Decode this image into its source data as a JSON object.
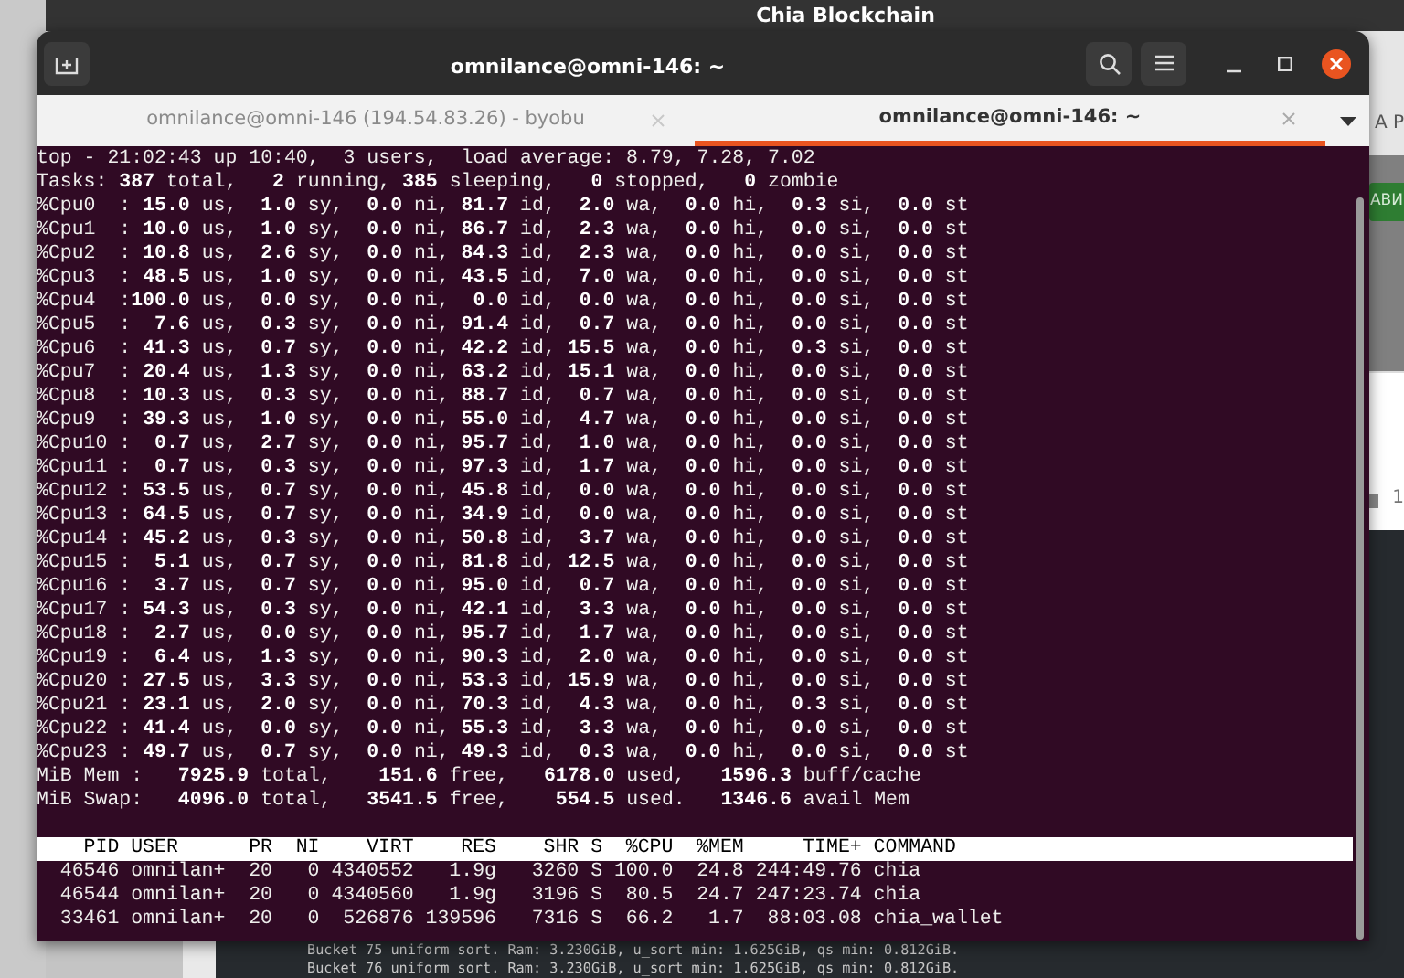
{
  "desktop": {
    "title": "Chia Blockchain"
  },
  "background_app": {
    "header_text": "A P",
    "button": "АВИ",
    "counter": "1",
    "log_lines": [
      "Bucket 75 uniform sort. Ram: 3.230GiB, u_sort min: 1.625GiB, qs min: 0.812GiB.",
      "Bucket 76 uniform sort. Ram: 3.230GiB, u_sort min: 1.625GiB, qs min: 0.812GiB."
    ]
  },
  "window": {
    "title": "omnilance@omni-146: ~"
  },
  "tabs": [
    {
      "label": "omnilance@omni-146 (194.54.83.26) - byobu",
      "selected": false
    },
    {
      "label": "omnilance@omni-146: ~",
      "selected": true
    }
  ],
  "terminal": {
    "lines": [
      "top - 21:02:43 up 10:40,  3 users,  load average: 8.79, 7.28, 7.02",
      "Tasks: **387** total,   **2** running, **385** sleeping,   **0** stopped,   **0** zombie",
      "%Cpu0  : **15.0** us,  **1.0** sy,  **0.0** ni, **81.7** id,  **2.0** wa,  **0.0** hi,  **0.3** si,  **0.0** st",
      "%Cpu1  : **10.0** us,  **1.0** sy,  **0.0** ni, **86.7** id,  **2.3** wa,  **0.0** hi,  **0.0** si,  **0.0** st",
      "%Cpu2  : **10.8** us,  **2.6** sy,  **0.0** ni, **84.3** id,  **2.3** wa,  **0.0** hi,  **0.0** si,  **0.0** st",
      "%Cpu3  : **48.5** us,  **1.0** sy,  **0.0** ni, **43.5** id,  **7.0** wa,  **0.0** hi,  **0.0** si,  **0.0** st",
      "%Cpu4  :**100.0** us,  **0.0** sy,  **0.0** ni,  **0.0** id,  **0.0** wa,  **0.0** hi,  **0.0** si,  **0.0** st",
      "%Cpu5  :  **7.6** us,  **0.3** sy,  **0.0** ni, **91.4** id,  **0.7** wa,  **0.0** hi,  **0.0** si,  **0.0** st",
      "%Cpu6  : **41.3** us,  **0.7** sy,  **0.0** ni, **42.2** id, **15.5** wa,  **0.0** hi,  **0.3** si,  **0.0** st",
      "%Cpu7  : **20.4** us,  **1.3** sy,  **0.0** ni, **63.2** id, **15.1** wa,  **0.0** hi,  **0.0** si,  **0.0** st",
      "%Cpu8  : **10.3** us,  **0.3** sy,  **0.0** ni, **88.7** id,  **0.7** wa,  **0.0** hi,  **0.0** si,  **0.0** st",
      "%Cpu9  : **39.3** us,  **1.0** sy,  **0.0** ni, **55.0** id,  **4.7** wa,  **0.0** hi,  **0.0** si,  **0.0** st",
      "%Cpu10 :  **0.7** us,  **2.7** sy,  **0.0** ni, **95.7** id,  **1.0** wa,  **0.0** hi,  **0.0** si,  **0.0** st",
      "%Cpu11 :  **0.7** us,  **0.3** sy,  **0.0** ni, **97.3** id,  **1.7** wa,  **0.0** hi,  **0.0** si,  **0.0** st",
      "%Cpu12 : **53.5** us,  **0.7** sy,  **0.0** ni, **45.8** id,  **0.0** wa,  **0.0** hi,  **0.0** si,  **0.0** st",
      "%Cpu13 : **64.5** us,  **0.7** sy,  **0.0** ni, **34.9** id,  **0.0** wa,  **0.0** hi,  **0.0** si,  **0.0** st",
      "%Cpu14 : **45.2** us,  **0.3** sy,  **0.0** ni, **50.8** id,  **3.7** wa,  **0.0** hi,  **0.0** si,  **0.0** st",
      "%Cpu15 :  **5.1** us,  **0.7** sy,  **0.0** ni, **81.8** id, **12.5** wa,  **0.0** hi,  **0.0** si,  **0.0** st",
      "%Cpu16 :  **3.7** us,  **0.7** sy,  **0.0** ni, **95.0** id,  **0.7** wa,  **0.0** hi,  **0.0** si,  **0.0** st",
      "%Cpu17 : **54.3** us,  **0.3** sy,  **0.0** ni, **42.1** id,  **3.3** wa,  **0.0** hi,  **0.0** si,  **0.0** st",
      "%Cpu18 :  **2.7** us,  **0.0** sy,  **0.0** ni, **95.7** id,  **1.7** wa,  **0.0** hi,  **0.0** si,  **0.0** st",
      "%Cpu19 :  **6.4** us,  **1.3** sy,  **0.0** ni, **90.3** id,  **2.0** wa,  **0.0** hi,  **0.0** si,  **0.0** st",
      "%Cpu20 : **27.5** us,  **3.3** sy,  **0.0** ni, **53.3** id, **15.9** wa,  **0.0** hi,  **0.0** si,  **0.0** st",
      "%Cpu21 : **23.1** us,  **2.0** sy,  **0.0** ni, **70.3** id,  **4.3** wa,  **0.0** hi,  **0.3** si,  **0.0** st",
      "%Cpu22 : **41.4** us,  **0.0** sy,  **0.0** ni, **55.3** id,  **3.3** wa,  **0.0** hi,  **0.0** si,  **0.0** st",
      "%Cpu23 : **49.7** us,  **0.7** sy,  **0.0** ni, **49.3** id,  **0.3** wa,  **0.0** hi,  **0.0** si,  **0.0** st",
      "MiB Mem :   **7925.9** total,    **151.6** free,   **6178.0** used,   **1596.3** buff/cache",
      "MiB Swap:   **4096.0** total,   **3541.5** free,    **554.5** used.   **1346.6** avail Mem"
    ],
    "process_table": {
      "columns": [
        "PID",
        "USER",
        "PR",
        "NI",
        "VIRT",
        "RES",
        "SHR",
        "S",
        "%CPU",
        "%MEM",
        "TIME+",
        "COMMAND"
      ],
      "rows": [
        [
          "46546",
          "omnilan+",
          "20",
          "0",
          "4340552",
          "1.9g",
          "3260",
          "S",
          "100.0",
          "24.8",
          "244:49.76",
          "chia"
        ],
        [
          "46544",
          "omnilan+",
          "20",
          "0",
          "4340560",
          "1.9g",
          "3196",
          "S",
          "80.5",
          "24.7",
          "247:23.74",
          "chia"
        ],
        [
          "33461",
          "omnilan+",
          "20",
          "0",
          "526876",
          "139596",
          "7316",
          "S",
          "66.2",
          "1.7",
          "88:03.08",
          "chia_wallet"
        ]
      ]
    }
  }
}
